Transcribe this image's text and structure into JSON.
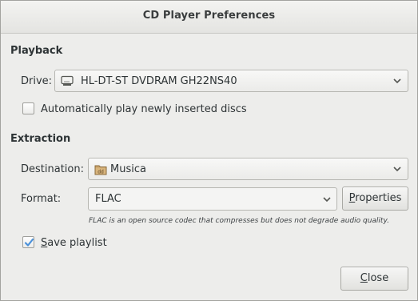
{
  "window": {
    "title": "CD Player Preferences"
  },
  "playback": {
    "section_title": "Playback",
    "drive_label": "Drive:",
    "drive_value": "HL-DT-ST DVDRAM GH22NS40",
    "autoplay_label": "Automatically play newly inserted discs",
    "autoplay_checked": false
  },
  "extraction": {
    "section_title": "Extraction",
    "destination_label": "Destination:",
    "destination_value": "Musica",
    "format_label": "Format:",
    "format_value": "FLAC",
    "properties_first": "P",
    "properties_rest": "roperties",
    "format_hint": "FLAC is an open source codec that compresses but does not degrade audio quality.",
    "save_playlist_first": "S",
    "save_playlist_rest": "ave playlist",
    "save_playlist_checked": true
  },
  "footer": {
    "close_first": "C",
    "close_rest": "lose"
  },
  "colors": {
    "check_blue": "#4a90d9"
  },
  "icons": {
    "drive": "harddisk-icon",
    "destination": "music-folder-icon",
    "dropdown": "chevron-down-icon",
    "check": "checkmark-icon"
  }
}
